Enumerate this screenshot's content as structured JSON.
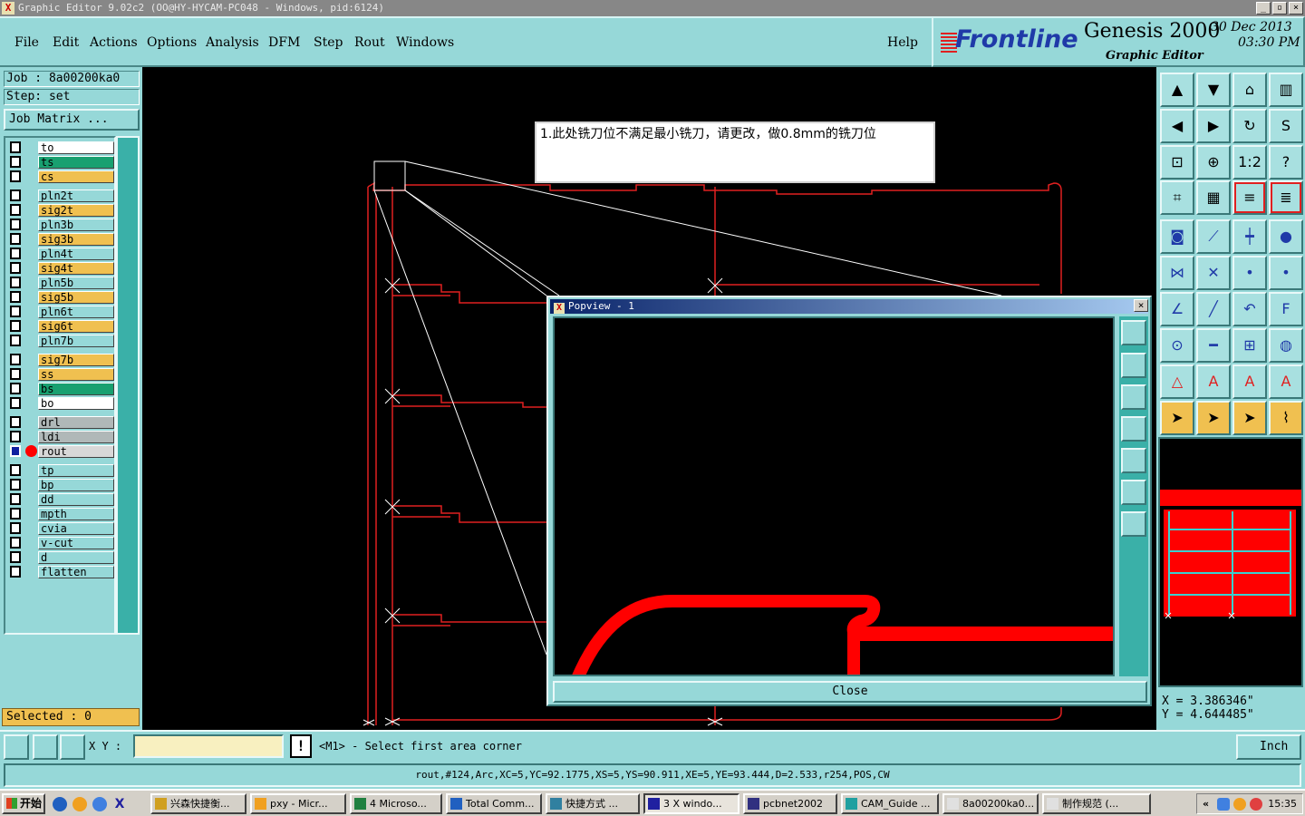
{
  "titlebar": {
    "title": "Graphic Editor 9.02c2 (OO@HY-HYCAM-PC048 - Windows, pid:6124)",
    "app_icon": "X",
    "minimize": "_",
    "restore": "▫",
    "close": "×"
  },
  "menu": {
    "items": [
      "File",
      "Edit",
      "Actions",
      "Options",
      "Analysis",
      "DFM",
      "Step",
      "Rout",
      "Windows"
    ],
    "help": "Help"
  },
  "logo": {
    "brand": "Frontline",
    "product": "Genesis 2000",
    "subtitle": "Graphic Editor",
    "date": "30 Dec 2013",
    "time": "03:30 PM"
  },
  "job": {
    "job_label": "Job : 8a00200ka0",
    "step_label": "Step: set",
    "matrix_button": "Job Matrix ..."
  },
  "layers": [
    {
      "name": "to",
      "color": "#ffffff"
    },
    {
      "name": "ts",
      "color": "#18a070"
    },
    {
      "name": "cs",
      "color": "#f0c050"
    },
    {
      "name": "pln2t",
      "color": "#96d8d8"
    },
    {
      "name": "sig2t",
      "color": "#f0c050"
    },
    {
      "name": "pln3b",
      "color": "#96d8d8"
    },
    {
      "name": "sig3b",
      "color": "#f0c050"
    },
    {
      "name": "pln4t",
      "color": "#96d8d8"
    },
    {
      "name": "sig4t",
      "color": "#f0c050"
    },
    {
      "name": "pln5b",
      "color": "#96d8d8"
    },
    {
      "name": "sig5b",
      "color": "#f0c050"
    },
    {
      "name": "pln6t",
      "color": "#96d8d8"
    },
    {
      "name": "sig6t",
      "color": "#f0c050"
    },
    {
      "name": "pln7b",
      "color": "#96d8d8"
    },
    {
      "name": "sig7b",
      "color": "#f0c050"
    },
    {
      "name": "ss",
      "color": "#f0c050"
    },
    {
      "name": "bs",
      "color": "#18a070"
    },
    {
      "name": "bo",
      "color": "#ffffff"
    },
    {
      "name": "drl",
      "color": "#b0b8b8"
    },
    {
      "name": "ldi",
      "color": "#b0b8b8"
    },
    {
      "name": "rout",
      "color": "#d8d8d8",
      "active": true
    },
    {
      "name": "tp",
      "color": "#96d8d8"
    },
    {
      "name": "bp",
      "color": "#96d8d8"
    },
    {
      "name": "dd",
      "color": "#96d8d8"
    },
    {
      "name": "mpth",
      "color": "#96d8d8"
    },
    {
      "name": "cvia",
      "color": "#96d8d8"
    },
    {
      "name": "v-cut",
      "color": "#96d8d8"
    },
    {
      "name": "d",
      "color": "#96d8d8"
    },
    {
      "name": "flatten",
      "color": "#96d8d8"
    }
  ],
  "selected_label": "Selected : 0",
  "annotation": {
    "text": "1.此处铣刀位不满足最小铣刀，请更改，做0.8mm的铣刀位"
  },
  "popview": {
    "title": "Popview - 1",
    "close_label": "Close"
  },
  "coords": {
    "x": "X = 3.386346\"",
    "y": "Y = 4.644485\""
  },
  "status": {
    "xy_label": "X Y :",
    "xy_value": "",
    "exclaim": "!",
    "prompt": "<M1> - Select first area corner",
    "unit": "Inch",
    "feature": "rout,#124,Arc,XC=5,YC=92.1775,XS=5,YS=90.911,XE=5,YE=93.444,D=2.533,r254,POS,CW"
  },
  "taskbar": {
    "start": "开始",
    "tasks": [
      "兴森快捷衡...",
      "pxy - Micr...",
      "4 Microso...",
      "Total Comm...",
      "快捷方式 ...",
      "3 X windo...",
      "pcbnet2002",
      "CAM_Guide ...",
      "8a00200ka0...",
      "制作规范 (..."
    ],
    "clock": "15:35"
  },
  "colors": {
    "panel": "#96d8d8",
    "accent_red": "#ff0000",
    "rout_line": "#e02020",
    "brand_blue": "#1f3aa8"
  }
}
